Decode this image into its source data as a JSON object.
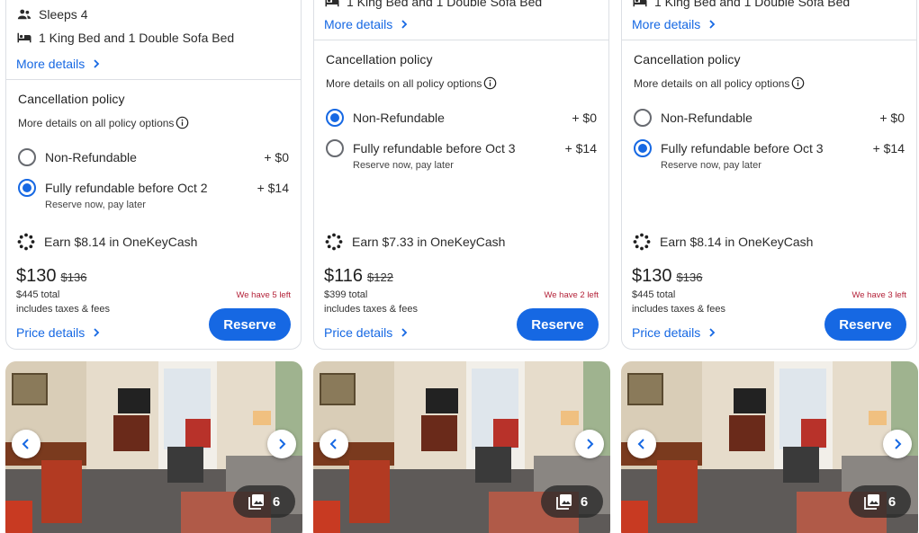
{
  "cards": [
    {
      "features": [
        {
          "icon": "people-icon",
          "text": "Sleeps 4"
        },
        {
          "icon": "bed-icon",
          "text": "1 King Bed and 1 Double Sofa Bed"
        }
      ],
      "more_details": "More details",
      "cancellation": {
        "title": "Cancellation policy",
        "subtitle": "More details on all policy options",
        "options": [
          {
            "label": "Non-Refundable",
            "price": "+ $0",
            "selected": false,
            "note": ""
          },
          {
            "label": "Fully refundable before Oct 2",
            "price": "+ $14",
            "selected": true,
            "note": "Reserve now, pay later"
          }
        ]
      },
      "earn": "Earn $8.14 in OneKeyCash",
      "price": "$130",
      "old_price": "$136",
      "total": "$445 total",
      "taxes": "includes taxes & fees",
      "left": "We have 5 left",
      "price_details": "Price details",
      "reserve": "Reserve",
      "photo_count": "6"
    },
    {
      "features": [
        {
          "icon": "bed-icon",
          "text": "1 King Bed and 1 Double Sofa Bed"
        }
      ],
      "more_details": "More details",
      "cancellation": {
        "title": "Cancellation policy",
        "subtitle": "More details on all policy options",
        "options": [
          {
            "label": "Non-Refundable",
            "price": "+ $0",
            "selected": true,
            "note": ""
          },
          {
            "label": "Fully refundable before Oct 3",
            "price": "+ $14",
            "selected": false,
            "note": "Reserve now, pay later"
          }
        ]
      },
      "earn": "Earn $7.33 in OneKeyCash",
      "price": "$116",
      "old_price": "$122",
      "total": "$399 total",
      "taxes": "includes taxes & fees",
      "left": "We have 2 left",
      "price_details": "Price details",
      "reserve": "Reserve",
      "photo_count": "6"
    },
    {
      "features": [
        {
          "icon": "bed-icon",
          "text": "1 King Bed and 1 Double Sofa Bed"
        }
      ],
      "more_details": "More details",
      "cancellation": {
        "title": "Cancellation policy",
        "subtitle": "More details on all policy options",
        "options": [
          {
            "label": "Non-Refundable",
            "price": "+ $0",
            "selected": false,
            "note": ""
          },
          {
            "label": "Fully refundable before Oct 3",
            "price": "+ $14",
            "selected": true,
            "note": "Reserve now, pay later"
          }
        ]
      },
      "earn": "Earn $8.14 in OneKeyCash",
      "price": "$130",
      "old_price": "$136",
      "total": "$445 total",
      "taxes": "includes taxes & fees",
      "left": "We have 3 left",
      "price_details": "Price details",
      "reserve": "Reserve",
      "photo_count": "6"
    }
  ],
  "colors": {
    "accent": "#1668e3",
    "alert": "#b4233a",
    "border": "#dcdfe4"
  }
}
